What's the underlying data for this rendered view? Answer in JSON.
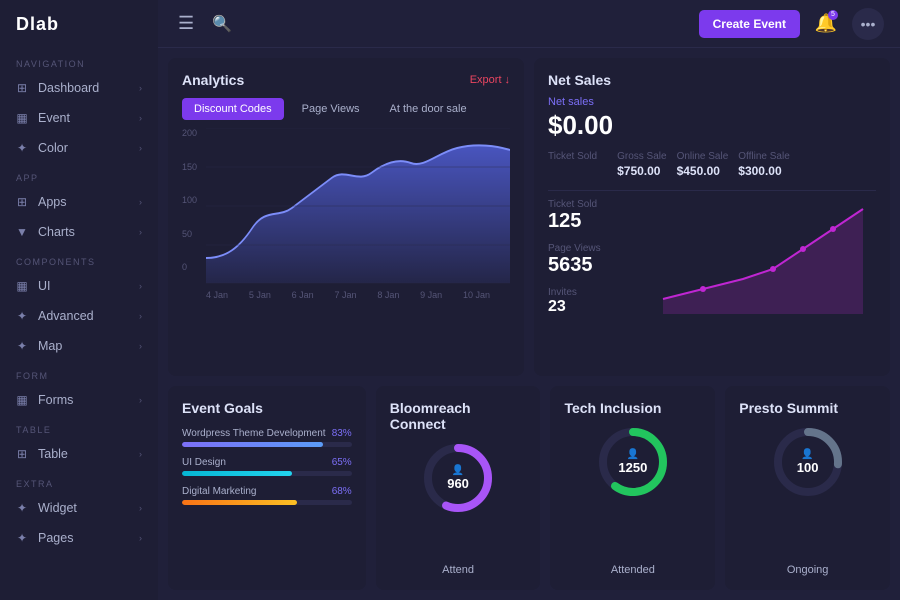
{
  "app": {
    "logo": "Dlab"
  },
  "sidebar": {
    "nav_label": "NAVIGATION",
    "app_label": "APP",
    "components_label": "COMPONENTS",
    "form_label": "FORM",
    "table_label": "TABLE",
    "extra_label": "EXTRA",
    "items": [
      {
        "id": "dashboard",
        "label": "Dashboard",
        "icon": "⊞"
      },
      {
        "id": "event",
        "label": "Event",
        "icon": "▦"
      },
      {
        "id": "color",
        "label": "Color",
        "icon": "✦"
      },
      {
        "id": "apps",
        "label": "Apps",
        "icon": "⊞"
      },
      {
        "id": "charts",
        "label": "Charts",
        "icon": "▼"
      },
      {
        "id": "ui",
        "label": "UI",
        "icon": "▦"
      },
      {
        "id": "advanced",
        "label": "Advanced",
        "icon": "✦"
      },
      {
        "id": "map",
        "label": "Map",
        "icon": "✦"
      },
      {
        "id": "forms",
        "label": "Forms",
        "icon": "▦"
      },
      {
        "id": "table",
        "label": "Table",
        "icon": "⊞"
      },
      {
        "id": "widget",
        "label": "Widget",
        "icon": "✦"
      },
      {
        "id": "pages",
        "label": "Pages",
        "icon": "✦"
      }
    ]
  },
  "topbar": {
    "create_event_label": "Create Event",
    "notification_count": "5"
  },
  "analytics": {
    "title": "Analytics",
    "export_label": "Export",
    "tabs": [
      "Discount Codes",
      "Page Views",
      "At the door sale"
    ],
    "active_tab": 0,
    "y_labels": [
      "200",
      "150",
      "100",
      "50",
      "0"
    ],
    "x_labels": [
      "4 Jan",
      "5 Jan",
      "6 Jan",
      "7 Jan",
      "8 Jan",
      "9 Jan",
      "10 Jan"
    ]
  },
  "net_sales": {
    "title": "Net Sales",
    "net_sales_label": "Net sales",
    "net_sales_value": "$0.00",
    "gross_sale_label": "Gross Sale",
    "gross_sale_value": "$750.00",
    "online_sale_label": "Online Sale",
    "online_sale_value": "$450.00",
    "offline_sale_label": "Offline Sale",
    "offline_sale_value": "$300.00",
    "ticket_sold_label": "Ticket Sold",
    "ticket_sold_value": "125",
    "page_views_label": "Page Views",
    "page_views_value": "5635",
    "invites_label": "Invites",
    "invites_value": "23"
  },
  "event_goals": {
    "title": "Event Goals",
    "goals": [
      {
        "label": "Wordpress Theme Development",
        "pct": 83,
        "color": "#7c6ff7"
      },
      {
        "label": "UI Design",
        "pct": 65,
        "color": "#00bcd4"
      },
      {
        "label": "Digital Marketing",
        "pct": 68,
        "color": "#f97316"
      }
    ]
  },
  "bloomreach": {
    "title": "Bloomreach Connect",
    "value": "960",
    "label": "Attend",
    "color": "#a855f7",
    "bg_color": "#2a2a4a",
    "pct": 75
  },
  "tech_inclusion": {
    "title": "Tech Inclusion",
    "value": "1250",
    "label": "Attended",
    "color": "#22c55e",
    "bg_color": "#2a2a4a",
    "pct": 80
  },
  "presto_summit": {
    "title": "Presto Summit",
    "value": "100",
    "label": "Ongoing",
    "color": "#64748b",
    "bg_color": "#2a2a4a",
    "pct": 35
  }
}
